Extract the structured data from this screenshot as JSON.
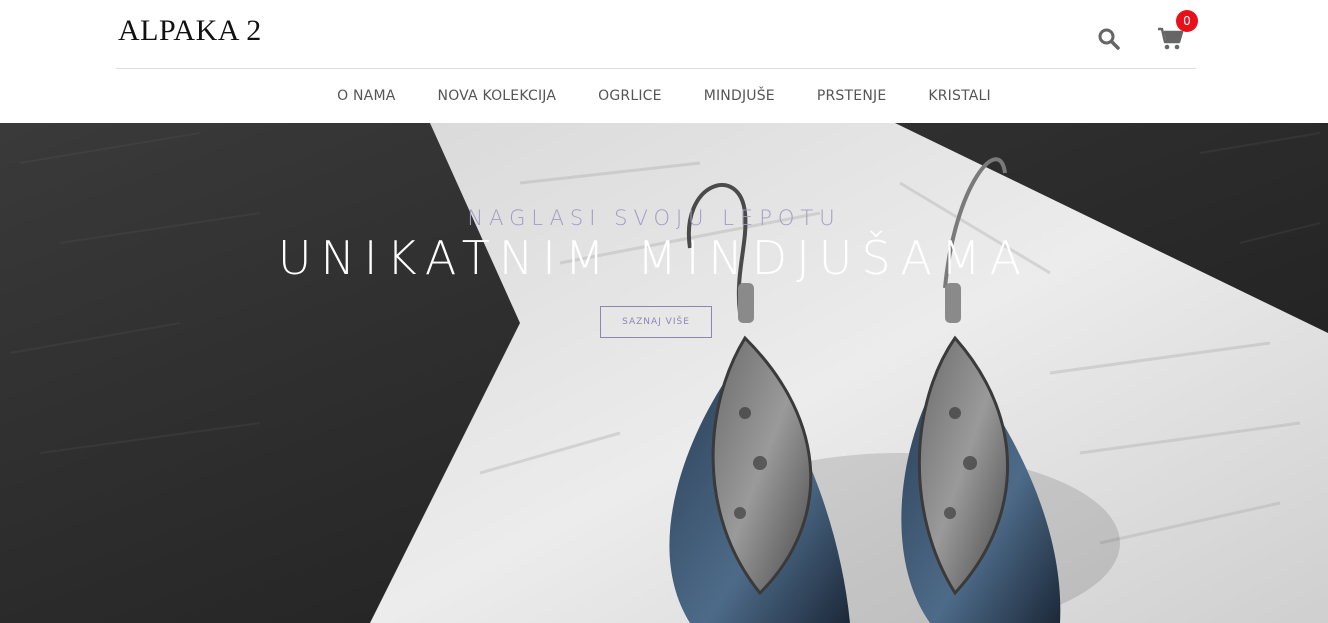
{
  "header": {
    "logo": "ALPAKA 2",
    "cart_count": "0",
    "search_icon": "search-icon",
    "cart_icon": "shopping-cart-icon"
  },
  "nav": {
    "items": [
      "O NAMA",
      "NOVA KOLEKCIJA",
      "OGRLICE",
      "MINDJUŠE",
      "PRSTENJE",
      "KRISTALI"
    ]
  },
  "hero": {
    "subtitle": "NAGLASI SVOJU LEPOTU",
    "title": "UNIKATNIM MINDJUŠAMA",
    "button_label": "SAZNAJ VIŠE"
  },
  "colors": {
    "accent": "#a29cc3",
    "badge": "#e8101a",
    "nav_text": "#555555"
  }
}
